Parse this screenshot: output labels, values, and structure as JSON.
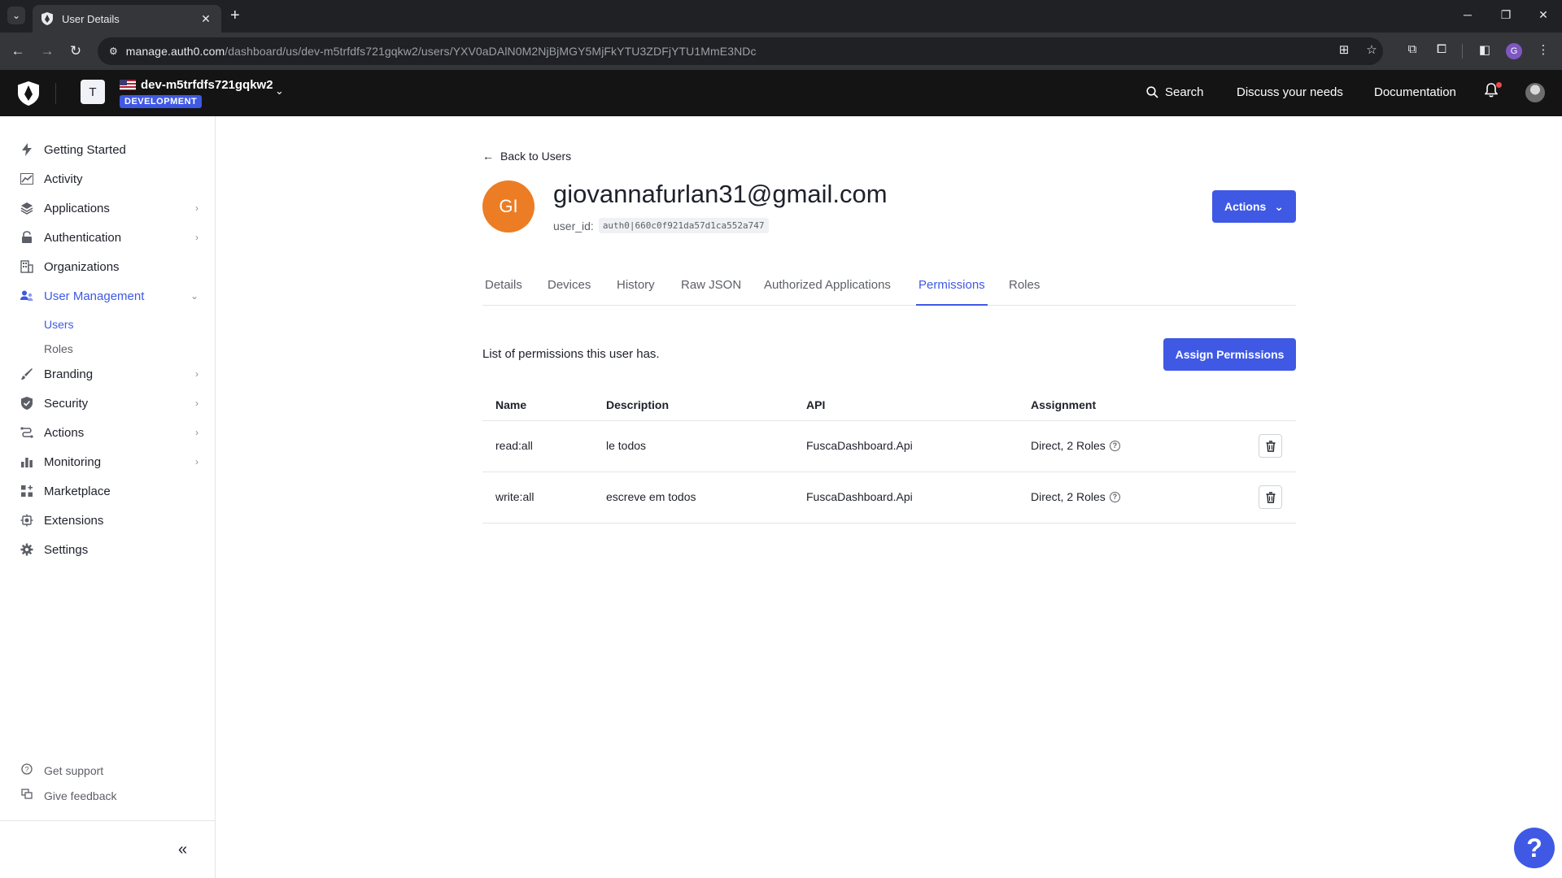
{
  "browser": {
    "tab_title": "User Details",
    "url_host": "manage.auth0.com",
    "url_path": "/dashboard/us/dev-m5trfdfs721gqkw2/users/YXV0aDAlN0M2NjBjMGY5MjFkYTU3ZDFjYTU1MmE3NDc",
    "profile_initial": "G"
  },
  "header": {
    "tenant_initial": "T",
    "tenant_name": "dev-m5trfdfs721gqkw2",
    "env_badge": "DEVELOPMENT",
    "search_label": "Search",
    "discuss_label": "Discuss your needs",
    "docs_label": "Documentation"
  },
  "sidebar": {
    "items": [
      {
        "label": "Getting Started",
        "icon": "lightning-icon"
      },
      {
        "label": "Activity",
        "icon": "chart-line-icon"
      },
      {
        "label": "Applications",
        "icon": "layers-icon"
      },
      {
        "label": "Authentication",
        "icon": "lock-icon"
      },
      {
        "label": "Organizations",
        "icon": "building-icon"
      },
      {
        "label": "User Management",
        "icon": "users-icon"
      },
      {
        "label": "Branding",
        "icon": "brush-icon"
      },
      {
        "label": "Security",
        "icon": "shield-check-icon"
      },
      {
        "label": "Actions",
        "icon": "flow-icon"
      },
      {
        "label": "Monitoring",
        "icon": "bar-chart-icon"
      },
      {
        "label": "Marketplace",
        "icon": "grid-plus-icon"
      },
      {
        "label": "Extensions",
        "icon": "puzzle-icon"
      },
      {
        "label": "Settings",
        "icon": "gear-icon"
      }
    ],
    "sub_items": [
      "Users",
      "Roles"
    ],
    "footer": {
      "support": "Get support",
      "feedback": "Give feedback"
    }
  },
  "main": {
    "back_label": "Back to Users",
    "avatar_initials": "GI",
    "email": "giovannafurlan31@gmail.com",
    "user_id_label": "user_id:",
    "user_id": "auth0|660c0f921da57d1ca552a747",
    "actions_label": "Actions",
    "tabs": [
      "Details",
      "Devices",
      "History",
      "Raw JSON",
      "Authorized Applications",
      "Permissions",
      "Roles"
    ],
    "active_tab": "Permissions",
    "permissions_description": "List of permissions this user has.",
    "assign_button": "Assign Permissions",
    "table": {
      "headers": [
        "Name",
        "Description",
        "API",
        "Assignment"
      ],
      "rows": [
        {
          "name": "read:all",
          "description": "le todos",
          "api": "FuscaDashboard.Api",
          "assignment": "Direct, 2 Roles"
        },
        {
          "name": "write:all",
          "description": "escreve em todos",
          "api": "FuscaDashboard.Api",
          "assignment": "Direct, 2 Roles"
        }
      ]
    }
  },
  "colors": {
    "accent": "#3f59e4",
    "avatar": "#ec7d24",
    "header_bg": "#141414"
  }
}
